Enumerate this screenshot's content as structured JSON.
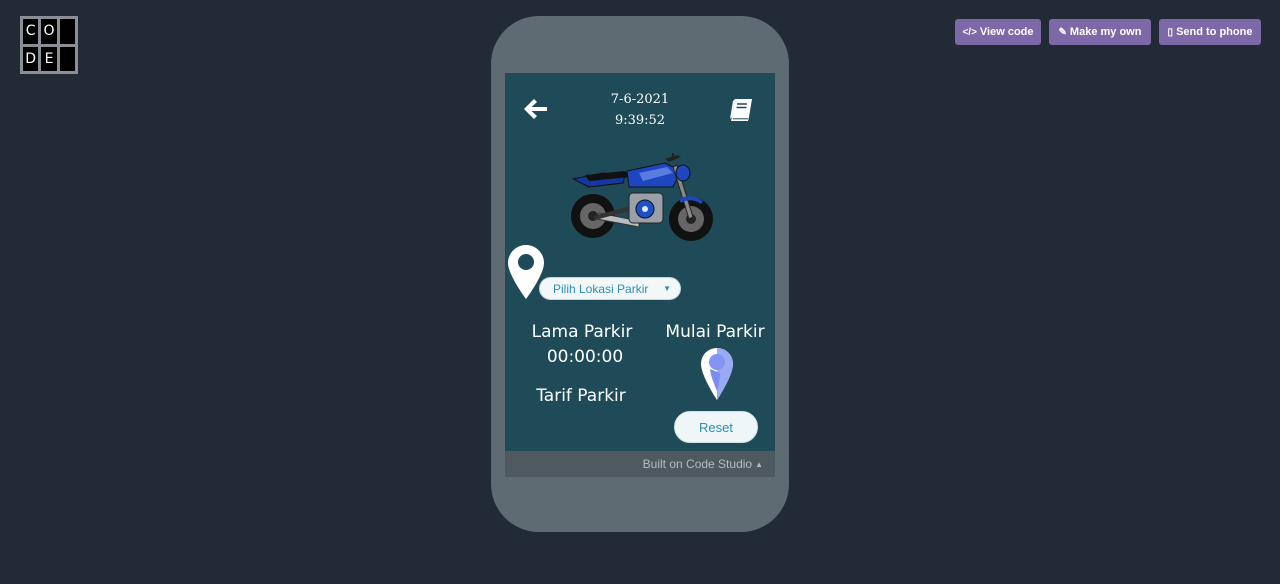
{
  "logo": {
    "letters": [
      "C",
      "O",
      "D",
      "E"
    ]
  },
  "toolbar": {
    "view_code": "View code",
    "make_my_own": "Make my own",
    "send_to_phone": "Send to phone",
    "button_color": "#7d68a8"
  },
  "app": {
    "date": "7-6-2021",
    "time": "9:39:52",
    "location_dropdown": "Pilih Lokasi Parkir",
    "lama_parkir_label": "Lama Parkir",
    "timer": "00:00:00",
    "tarif_parkir_label": "Tarif Parkir",
    "mulai_parkir_label": "Mulai Parkir",
    "reset_button": "Reset",
    "background": "#1f4a57",
    "icons": [
      "arrow-left-icon",
      "book-icon",
      "motorcycle-image",
      "location-pin-icon",
      "location-pin-start-icon"
    ]
  },
  "footer": {
    "text": "Built on Code Studio"
  }
}
